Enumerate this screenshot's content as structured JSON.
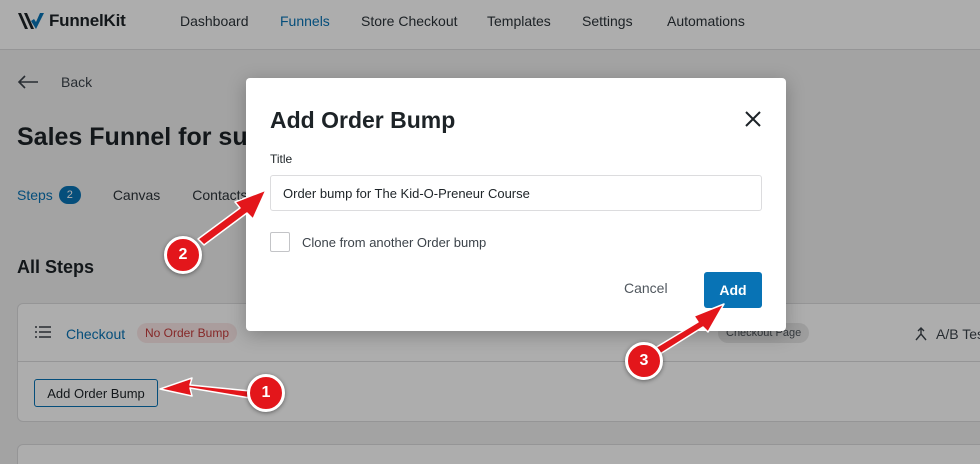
{
  "brand": {
    "name": "FunnelKit",
    "accent": "#0873b5",
    "marker_color": "#e3161b"
  },
  "nav": {
    "items": [
      {
        "label": "Dashboard",
        "active": false
      },
      {
        "label": "Funnels",
        "active": true
      },
      {
        "label": "Store Checkout",
        "active": false
      },
      {
        "label": "Templates",
        "active": false
      },
      {
        "label": "Settings",
        "active": false
      },
      {
        "label": "Automations",
        "active": false
      }
    ]
  },
  "page": {
    "back_label": "Back",
    "title": "Sales Funnel for su",
    "tabs": [
      {
        "label": "Steps",
        "count": "2",
        "active": true
      },
      {
        "label": "Canvas"
      },
      {
        "label": "Contacts"
      }
    ],
    "section_title": "All Steps",
    "step": {
      "name": "Checkout",
      "status_badge": "No Order Bump",
      "type_badge": "Checkout Page",
      "ab_label": "A/B Test",
      "add_bump_label": "Add Order Bump"
    }
  },
  "modal": {
    "title": "Add Order Bump",
    "field_label": "Title",
    "title_value": "Order bump for The Kid-O-Preneur Course",
    "clone_label": "Clone from another Order bump",
    "clone_checked": false,
    "cancel_label": "Cancel",
    "add_label": "Add"
  },
  "annotations": {
    "markers": [
      "1",
      "2",
      "3"
    ]
  },
  "icons": [
    "funnelkit-logo-icon",
    "back-arrow-icon",
    "drag-handle-icon",
    "ab-test-icon",
    "close-icon"
  ]
}
